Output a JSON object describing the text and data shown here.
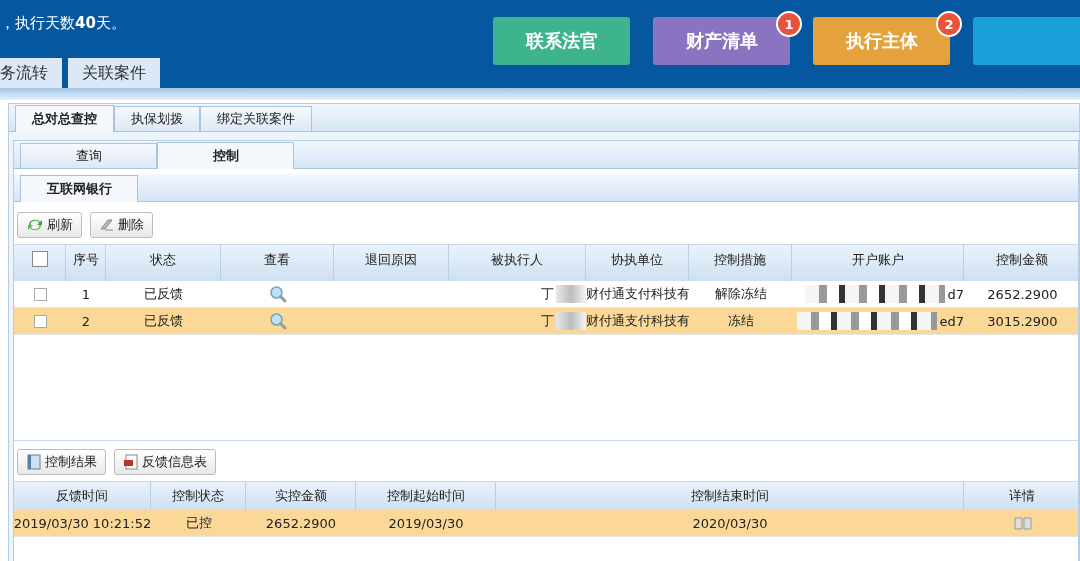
{
  "header": {
    "info": "，执行天数**40**天。",
    "tabs": [
      {
        "label": "务流转",
        "selected": false
      },
      {
        "label": "关联案件",
        "selected": false
      }
    ],
    "buttons": [
      {
        "label": "联系法官",
        "color": "#3db48d"
      },
      {
        "label": "财产清单",
        "color": "#8a74c2",
        "badge": "1"
      },
      {
        "label": "执行主体",
        "color": "#e5a23c",
        "badge": "2"
      },
      {
        "color": "#1aa0d8"
      }
    ]
  },
  "tabs_level1": [
    {
      "label": "总对总查控",
      "selected": true
    },
    {
      "label": "执保划拨",
      "selected": false
    },
    {
      "label": "绑定关联案件",
      "selected": false
    }
  ],
  "tabs_level2": [
    {
      "label": "查询",
      "selected": false
    },
    {
      "label": "控制",
      "selected": true
    }
  ],
  "tabs_level3": [
    {
      "label": "互联网银行",
      "selected": true
    }
  ],
  "toolbar": [
    {
      "label": "刷新",
      "kind": "refresh"
    },
    {
      "label": "删除",
      "kind": "delete"
    }
  ],
  "table": {
    "header_checked": false,
    "columns": [
      "序号",
      "状态",
      "查看",
      "退回原因",
      "被执行人",
      "协执单位",
      "控制措施",
      "开户账户",
      "控制金额"
    ],
    "rows": [
      {
        "checked": false,
        "selected": false,
        "no": "1",
        "status": "已反馈",
        "person": "丁",
        "unit": "财付通支付科技有",
        "measure": "解除冻结",
        "account": "d7",
        "amount": "2652.2900"
      },
      {
        "checked": false,
        "selected": true,
        "no": "2",
        "status": "已反馈",
        "person": "丁",
        "unit": "财付通支付科技有",
        "measure": "冻结",
        "account": "ed7",
        "amount": "3015.2900"
      }
    ]
  },
  "result_toolbar": [
    {
      "label": "控制结果",
      "kind": "result"
    },
    {
      "label": "反馈信息表",
      "kind": "form"
    }
  ],
  "result_table": {
    "columns": [
      "反馈时间",
      "控制状态",
      "实控金额",
      "控制起始时间",
      "控制结束时间",
      "详情"
    ],
    "rows": [
      {
        "selected": true,
        "cells": [
          "2019/03/30 10:21:52",
          "已控",
          "2652.2900",
          "2019/03/30",
          "2020/03/30"
        ]
      }
    ]
  }
}
